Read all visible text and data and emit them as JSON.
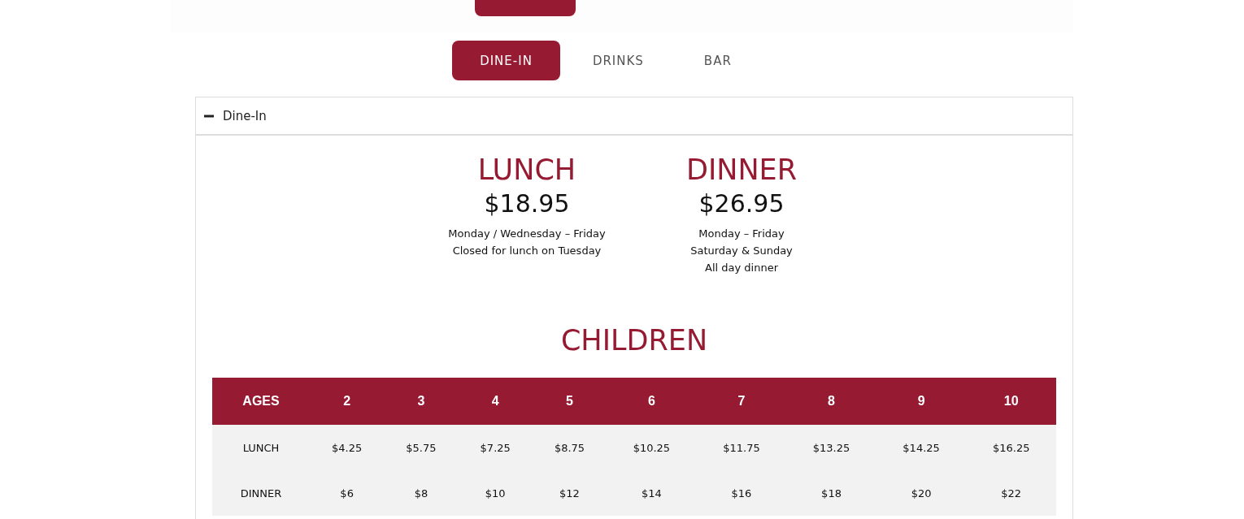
{
  "tabs": [
    {
      "label": "DINE-IN",
      "selected": true
    },
    {
      "label": "DRINKS",
      "selected": false
    },
    {
      "label": "BAR",
      "selected": false
    }
  ],
  "accordion": {
    "title": "Dine-In",
    "expanded": true,
    "meals": [
      {
        "title": "LUNCH",
        "price": "$18.95",
        "notes": [
          "Monday / Wednesday – Friday",
          "Closed for lunch on Tuesday"
        ]
      },
      {
        "title": "DINNER",
        "price": "$26.95",
        "notes": [
          "Monday – Friday",
          "Saturday & Sunday",
          "All day dinner"
        ]
      }
    ],
    "children": {
      "title": "CHILDREN",
      "columns": [
        "AGES",
        "2",
        "3",
        "4",
        "5",
        "6",
        "7",
        "8",
        "9",
        "10"
      ],
      "rows": [
        [
          "LUNCH",
          "$4.25",
          "$5.75",
          "$7.25",
          "$8.75",
          "$10.25",
          "$11.75",
          "$13.25",
          "$14.25",
          "$16.25"
        ],
        [
          "DINNER",
          "$6",
          "$8",
          "$10",
          "$12",
          "$14",
          "$16",
          "$18",
          "$20",
          "$22"
        ]
      ]
    }
  }
}
